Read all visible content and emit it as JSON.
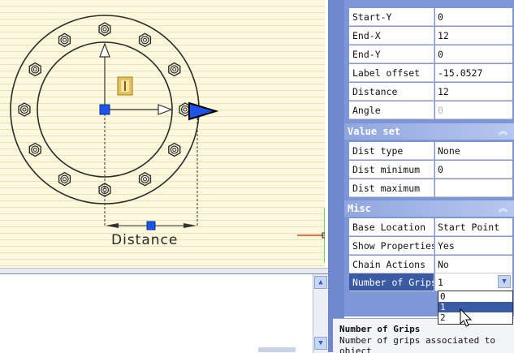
{
  "drawing": {
    "dimension_label": "Distance"
  },
  "properties": {
    "rows_top": [
      {
        "name": "Start-Y",
        "value": "0"
      },
      {
        "name": "End-X",
        "value": "12"
      },
      {
        "name": "End-Y",
        "value": "0"
      },
      {
        "name": "Label offset",
        "value": "-15.0527"
      },
      {
        "name": "Distance",
        "value": "12"
      },
      {
        "name": "Angle",
        "value": "0"
      }
    ],
    "value_set": {
      "title": "Value set",
      "rows": [
        {
          "name": "Dist type",
          "value": "None"
        },
        {
          "name": "Dist minimum",
          "value": "0"
        },
        {
          "name": "Dist maximum",
          "value": ""
        }
      ]
    },
    "misc": {
      "title": "Misc",
      "rows": [
        {
          "name": "Base Location",
          "value": "Start Point"
        },
        {
          "name": "Show Properties",
          "value": "Yes"
        },
        {
          "name": "Chain Actions",
          "value": "No"
        },
        {
          "name": "Number of Grips",
          "value": "1"
        }
      ]
    },
    "grips_dropdown": {
      "options": [
        "0",
        "1",
        "2"
      ],
      "selected": "1"
    },
    "description": {
      "title": "Number of Grips",
      "text": "Number of grips associated to object"
    }
  },
  "colors": {
    "palette_bg": "#7d96d8",
    "section_header": "#90a6df",
    "selection": "#3a5aa4",
    "grip_blue": "#1a54e8",
    "canvas_bg": "#fbf8de"
  },
  "icons": [
    "scroll-up-icon",
    "scroll-down-icon",
    "collapse-chevron-icon",
    "dropdown-arrow-icon",
    "mouse-pointer-icon",
    "crosshair-cursor-icon",
    "parameter-icon"
  ]
}
